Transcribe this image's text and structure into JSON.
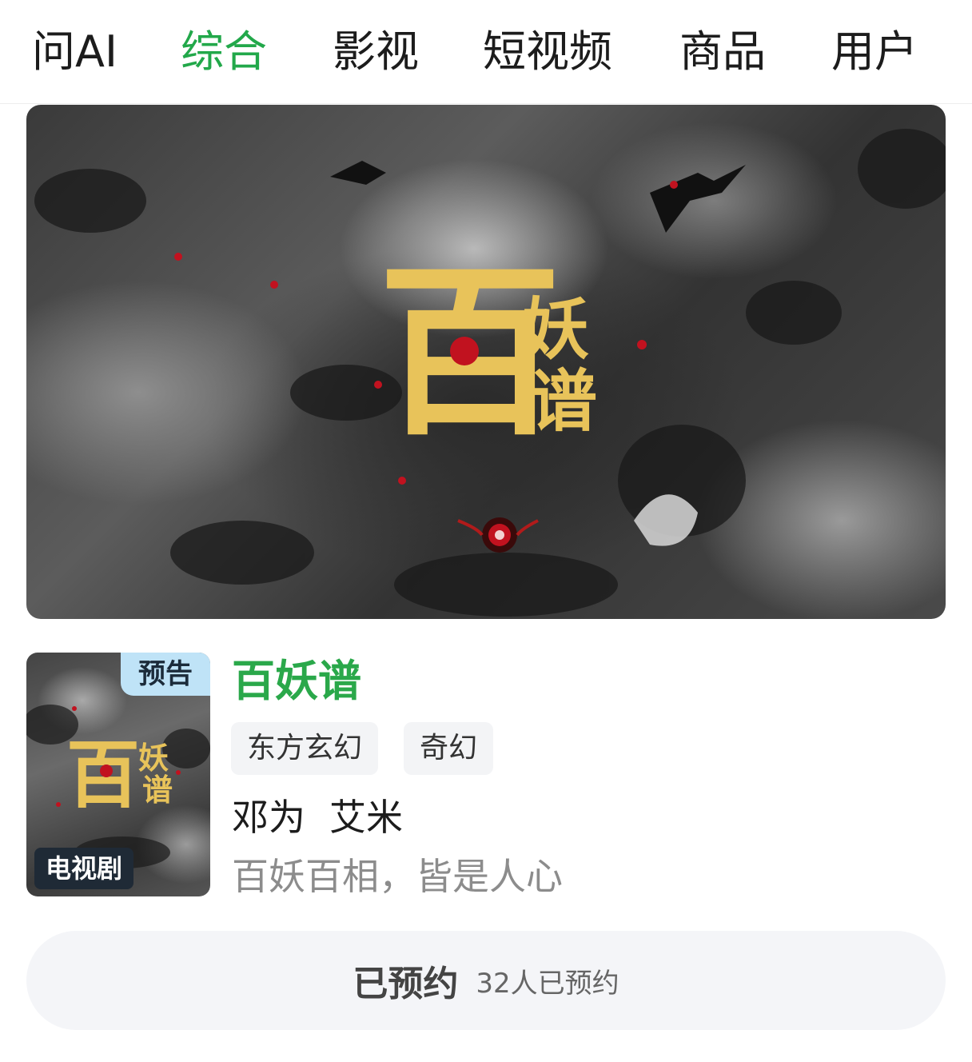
{
  "tabs": [
    {
      "label": "问AI",
      "active": false
    },
    {
      "label": "综合",
      "active": true
    },
    {
      "label": "影视",
      "active": false
    },
    {
      "label": "短视频",
      "active": false
    },
    {
      "label": "商品",
      "active": false
    },
    {
      "label": "用户",
      "active": false
    }
  ],
  "banner": {
    "calligraphy_big": "百",
    "calligraphy_small_1": "妖",
    "calligraphy_small_2": "谱"
  },
  "poster": {
    "badge_trailer": "预告",
    "badge_type": "电视剧",
    "calligraphy_big": "百",
    "calligraphy_small_1": "妖",
    "calligraphy_small_2": "谱"
  },
  "show": {
    "title": "百妖谱",
    "tags": [
      "东方玄幻",
      "奇幻"
    ],
    "cast": [
      "邓为",
      "艾米"
    ],
    "tagline": "百妖百相，皆是人心"
  },
  "reserve": {
    "label": "已预约",
    "count_text": "32人已预约"
  },
  "colors": {
    "accent_green": "#22a84a",
    "calligraphy_gold": "#e8c35a",
    "eye_red": "#c1121f"
  }
}
